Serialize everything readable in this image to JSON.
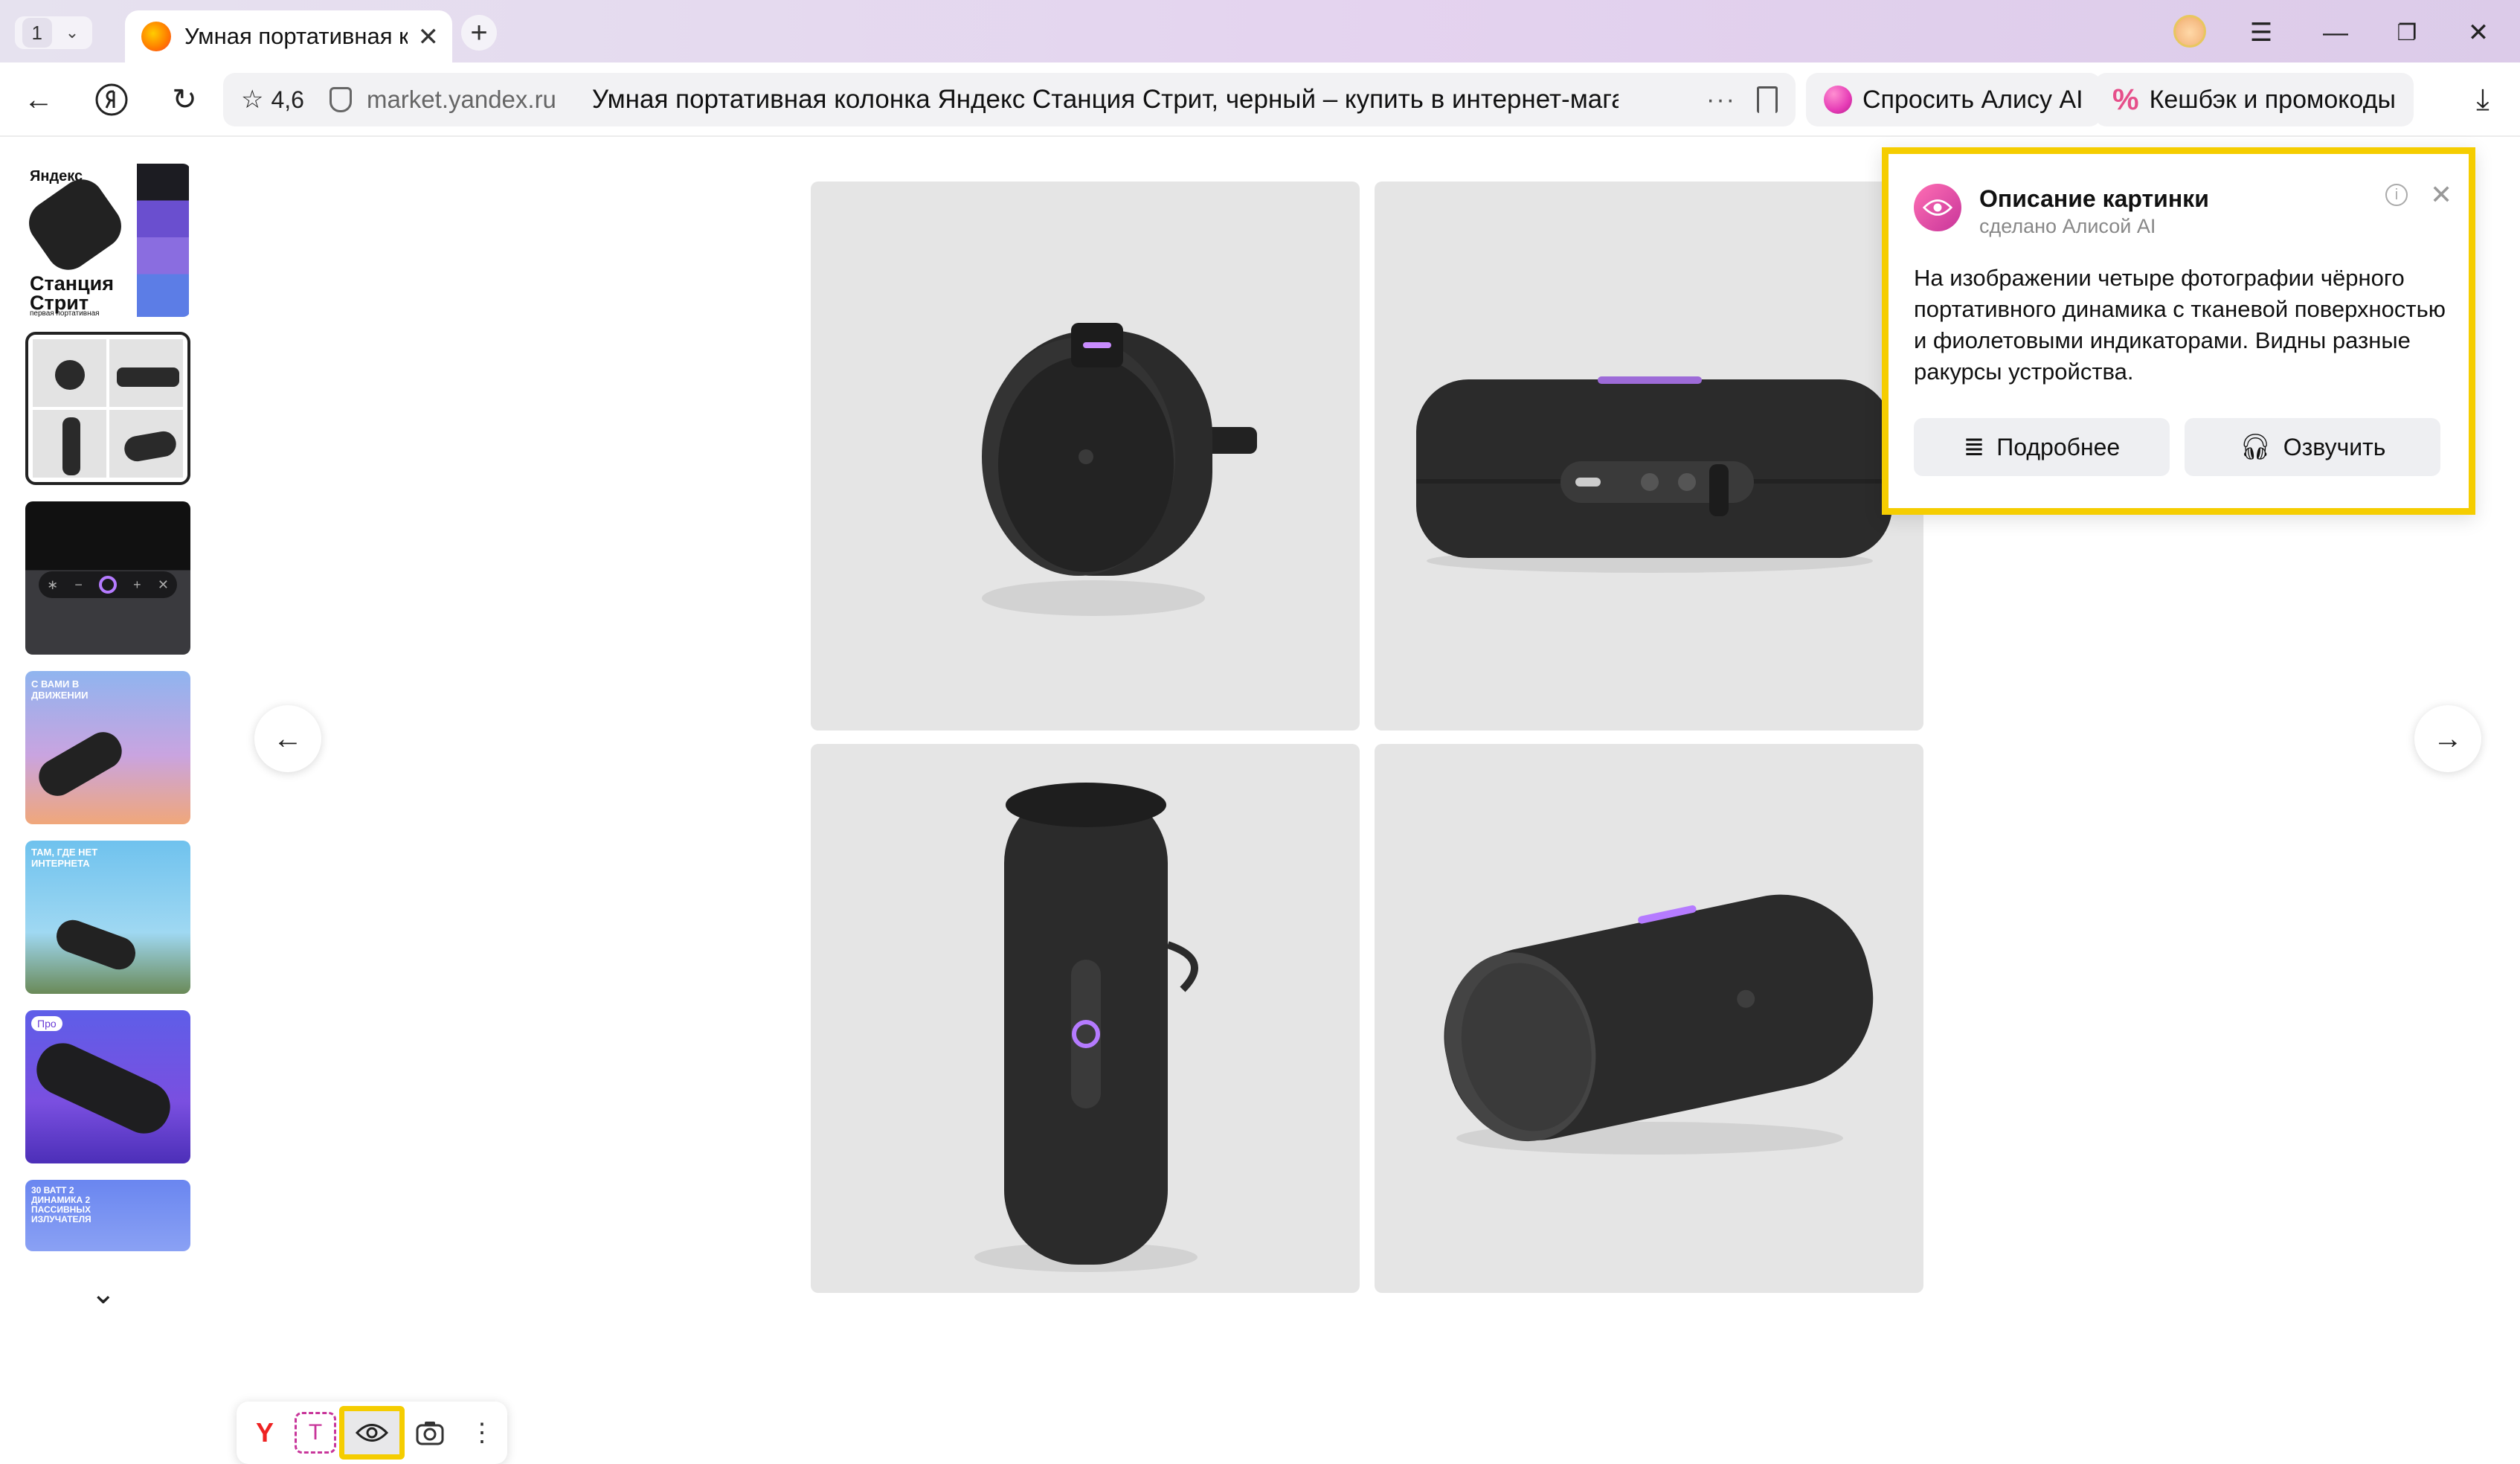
{
  "browser": {
    "tab_count": "1",
    "tab_title": "Умная портативная ко",
    "new_tab": "+",
    "window_controls": {
      "menu": "☰",
      "minimize": "—",
      "restore": "❐",
      "close": "✕"
    }
  },
  "addressbar": {
    "rating": "4,6",
    "domain": "market.yandex.ru",
    "page_title": "Умная портативная колонка Яндекс Станция Стрит, черный – купить в интернет-магази...",
    "ask_alice": "Спросить Алису AI",
    "cashback": "Кешбэк и промокоды"
  },
  "gallery": {
    "thumb1_brand": "Яндекс",
    "thumb1_title": "Станция Стрит",
    "thumb1_caption": "первая портативная",
    "thumb4_heading": "С ВАМИ В ДВИЖЕНИИ",
    "thumb5_heading": "ТАМ, ГДЕ НЕТ ИНТЕРНЕТА",
    "thumb6_badge": "Про",
    "thumb7_heading": "30 ВАТТ 2 ДИНАМИКА 2 ПАССИВНЫХ ИЗЛУЧАТЕЛЯ"
  },
  "popup": {
    "title": "Описание картинки",
    "subtitle": "сделано Алисой AI",
    "text": "На изображении четыре фотографии чёрного портативного динамика с тканевой поверхностью и фиолетовыми индикаторами. Видны разные ракурсы устройства.",
    "more_button": "Подробнее",
    "voice_button": "Озвучить"
  },
  "toolbar": {
    "yandex_icon": "Y",
    "translate_icon": "T"
  },
  "colors": {
    "highlight": "#f5cd00",
    "alice_pink": "#e63cb6",
    "accent_purple": "#b57bff"
  }
}
